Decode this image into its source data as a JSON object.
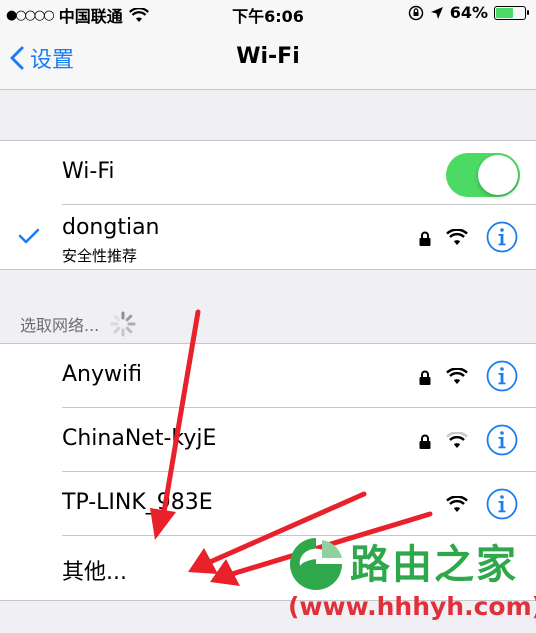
{
  "status_bar": {
    "signal": "●○○○○",
    "carrier": "中国联通",
    "time": "下午6:06",
    "battery_percent": "64%",
    "battery_level": 0.64
  },
  "nav": {
    "back_label": "设置",
    "title": "Wi-Fi"
  },
  "wifi_toggle": {
    "label": "Wi-Fi",
    "on": true
  },
  "connected_network": {
    "name": "dongtian",
    "subtitle": "安全性推荐",
    "secured": true,
    "signal_bars": 3
  },
  "choose_network": {
    "header": "选取网络..."
  },
  "networks": [
    {
      "name": "Anywifi",
      "secured": true,
      "signal_bars": 3
    },
    {
      "name": "ChinaNet-kyjE",
      "secured": true,
      "signal_bars": 2
    },
    {
      "name": "TP-LINK_983E",
      "secured": false,
      "signal_bars": 3
    }
  ],
  "other": {
    "label": "其他..."
  },
  "watermark": {
    "title": "路由之家",
    "url": "(www.hhhyh.com)"
  },
  "colors": {
    "accent": "#1a7cf0",
    "toggle_on": "#4cd964",
    "annotation_arrow": "#e8212b",
    "watermark_green": "#2ea84a",
    "watermark_red": "#e0303c"
  },
  "icons": {
    "back": "chevron-left-icon",
    "check": "checkmark-icon",
    "lock": "lock-icon",
    "wifi": "wifi-signal-icon",
    "info": "info-icon",
    "spinner": "activity-spinner-icon",
    "location": "location-arrow-icon",
    "orientation_lock": "orientation-lock-icon"
  }
}
